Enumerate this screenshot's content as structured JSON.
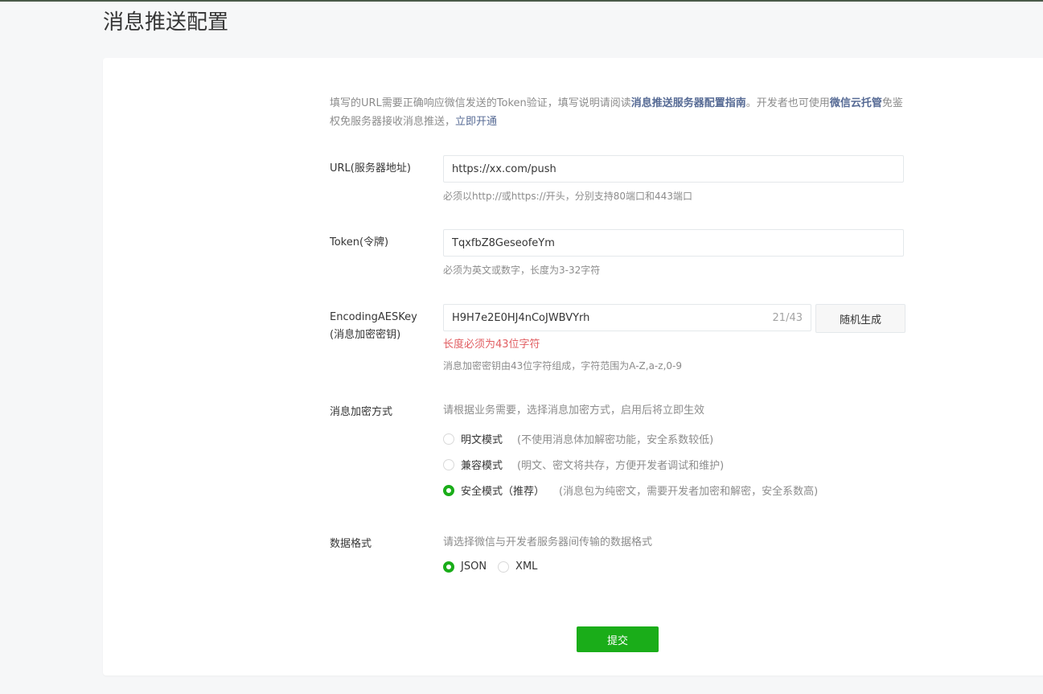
{
  "page_title": "消息推送配置",
  "notice": {
    "part1": "填写的URL需要正确响应微信发送的Token验证，填写说明请阅读",
    "link1": "消息推送服务器配置指南",
    "part2": "。开发者也可使用",
    "link2": "微信云托管",
    "part3": "免鉴权免服务器接收消息推送，",
    "link3": "立即开通"
  },
  "url_field": {
    "label": "URL(服务器地址)",
    "value": "https://xx.com/push",
    "help": "必须以http://或https://开头，分别支持80端口和443端口"
  },
  "token_field": {
    "label": "Token(令牌)",
    "value": "TqxfbZ8GeseofeYm",
    "help": "必须为英文或数字，长度为3-32字符"
  },
  "aes_field": {
    "label_line1": "EncodingAESKey",
    "label_line2": "(消息加密密钥)",
    "value": "H9H7e2E0HJ4nCoJWBVYrh",
    "counter": "21/43",
    "random_button": "随机生成",
    "error": "长度必须为43位字符",
    "help": "消息加密密钥由43位字符组成，字符范围为A-Z,a-z,0-9"
  },
  "encryption": {
    "label": "消息加密方式",
    "help": "请根据业务需要，选择消息加密方式，启用后将立即生效",
    "options": [
      {
        "label": "明文模式",
        "desc": "(不使用消息体加解密功能，安全系数较低)",
        "checked": false
      },
      {
        "label": "兼容模式",
        "desc": "(明文、密文将共存，方便开发者调试和维护)",
        "checked": false
      },
      {
        "label": "安全模式（推荐）",
        "desc": "(消息包为纯密文，需要开发者加密和解密，安全系数高)",
        "checked": true
      }
    ]
  },
  "data_format": {
    "label": "数据格式",
    "help": "请选择微信与开发者服务器间传输的数据格式",
    "options": [
      {
        "label": "JSON",
        "checked": true
      },
      {
        "label": "XML",
        "checked": false
      }
    ]
  },
  "submit_label": "提交",
  "colors": {
    "accent": "#1aad19",
    "link": "#576b95",
    "error": "#e15f63"
  }
}
